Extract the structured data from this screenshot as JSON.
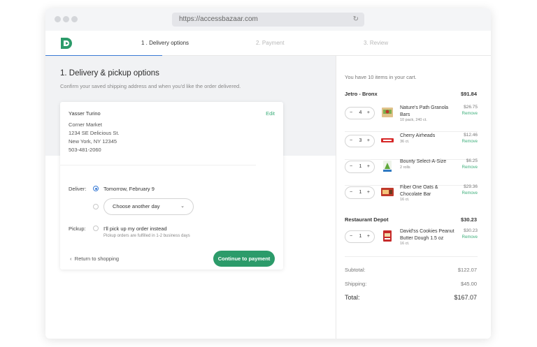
{
  "browser": {
    "url": "https://accessbazaar.com"
  },
  "steps": [
    {
      "label": "1 . Delivery options"
    },
    {
      "label": "2. Payment"
    },
    {
      "label": "3. Review"
    }
  ],
  "colors": {
    "accent": "#2c9b6a",
    "link": "#3cae7a",
    "step_underline": "#3a7bd5"
  },
  "delivery": {
    "heading": "1. Delivery & pickup options",
    "subheading": "Confirm your saved shipping address and when you'd like the order delivered.",
    "address": {
      "name": "Yasser Turino",
      "edit_label": "Edit",
      "lines": [
        "Corner Market",
        "1234 SE Delicious St.",
        "New York, NY 12345",
        "503-481-2060"
      ]
    },
    "deliver_label": "Deliver:",
    "deliver_option": "Tomorrow, February 9",
    "another_day": "Choose another day",
    "pickup_label": "Pickup:",
    "pickup_option": "I'll pick up my order instead",
    "pickup_note": "Pickup orders are fulfilled in 1-2 business days",
    "back_label": "Return to shopping",
    "continue_label": "Continue to payment"
  },
  "cart": {
    "intro": "You have 10 items in your cart.",
    "stores": [
      {
        "name": "Jetro - Bronx",
        "total": "$91.84",
        "items": [
          {
            "qty": "4",
            "name": "Nature's Path Granola Bars",
            "sub": "10 pack, 240 ct.",
            "price": "$26.75",
            "remove": "Remove"
          },
          {
            "qty": "3",
            "name": "Cherry Airheads",
            "sub": "36 ct.",
            "price": "$12.46",
            "remove": "Remove"
          },
          {
            "qty": "1",
            "name": "Bounty Select-A-Size",
            "sub": "2 rolls",
            "price": "$6.25",
            "remove": "Remove"
          },
          {
            "qty": "1",
            "name": "Fiber One Oats & Chocolate Bar",
            "sub": "16 ct.",
            "price": "$29.36",
            "remove": "Remove"
          }
        ]
      },
      {
        "name": "Restaurant Depot",
        "total": "$30.23",
        "items": [
          {
            "qty": "1",
            "name": "David'ss Cookies Peanut Butter Dough 1.5 oz",
            "sub": "16 ct.",
            "price": "$30.23",
            "remove": "Remove"
          }
        ]
      }
    ],
    "subtotal_label": "Subtotal:",
    "subtotal": "$122.07",
    "shipping_label": "Shipping:",
    "shipping": "$45.00",
    "total_label": "Total:",
    "total": "$167.07"
  }
}
